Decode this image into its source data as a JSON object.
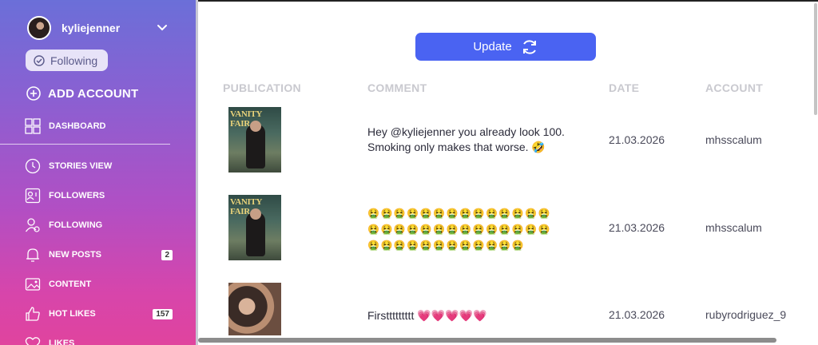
{
  "account": {
    "username": "kyliejenner",
    "following_label": "Following"
  },
  "add_account_label": "ADD ACCOUNT",
  "menu": [
    {
      "label": "DASHBOARD",
      "icon": "dashboard-icon"
    },
    {
      "label": "STORIES VIEW",
      "icon": "clock-icon"
    },
    {
      "label": "FOLLOWERS",
      "icon": "followers-icon"
    },
    {
      "label": "FOLLOWING",
      "icon": "following-icon"
    },
    {
      "label": "NEW POSTS",
      "icon": "bell-icon",
      "badge": "2"
    },
    {
      "label": "CONTENT",
      "icon": "image-icon"
    },
    {
      "label": "HOT LIKES",
      "icon": "thumbs-up-icon",
      "badge": "157"
    },
    {
      "label": "LIKES",
      "icon": "heart-icon"
    }
  ],
  "update_button": {
    "label": "Update"
  },
  "table": {
    "headers": {
      "publication": "PUBLICATION",
      "comment": "COMMENT",
      "date": "DATE",
      "account": "ACCOUNT"
    },
    "rows": [
      {
        "thumb_text": "VANITY FAIR",
        "comment": "Hey @kyliejenner you already look 100. Smoking only makes that worse. 🤣",
        "date": "21.03.2026",
        "account": "mhsscalum"
      },
      {
        "thumb_text": "VANITY FAIR",
        "comment_lines": [
          "🤮🤮🤮🤮🤮🤮🤮🤮🤮🤮🤮🤮🤮🤮",
          "🤮🤮🤮🤮🤮🤮🤮🤮🤮🤮🤮🤮🤮🤮",
          "🤮🤮🤮🤮🤮🤮🤮🤮🤮🤮🤮🤮"
        ],
        "date": "21.03.2026",
        "account": "mhsscalum"
      },
      {
        "comment": "Firsttttttttt 💗💗💗💗💗",
        "date": "21.03.2026",
        "account": "rubyrodriguez_9"
      }
    ]
  },
  "colors": {
    "accent": "#4a63f2",
    "sidebar_top": "#6b6fd8",
    "sidebar_bottom": "#e0449e"
  }
}
